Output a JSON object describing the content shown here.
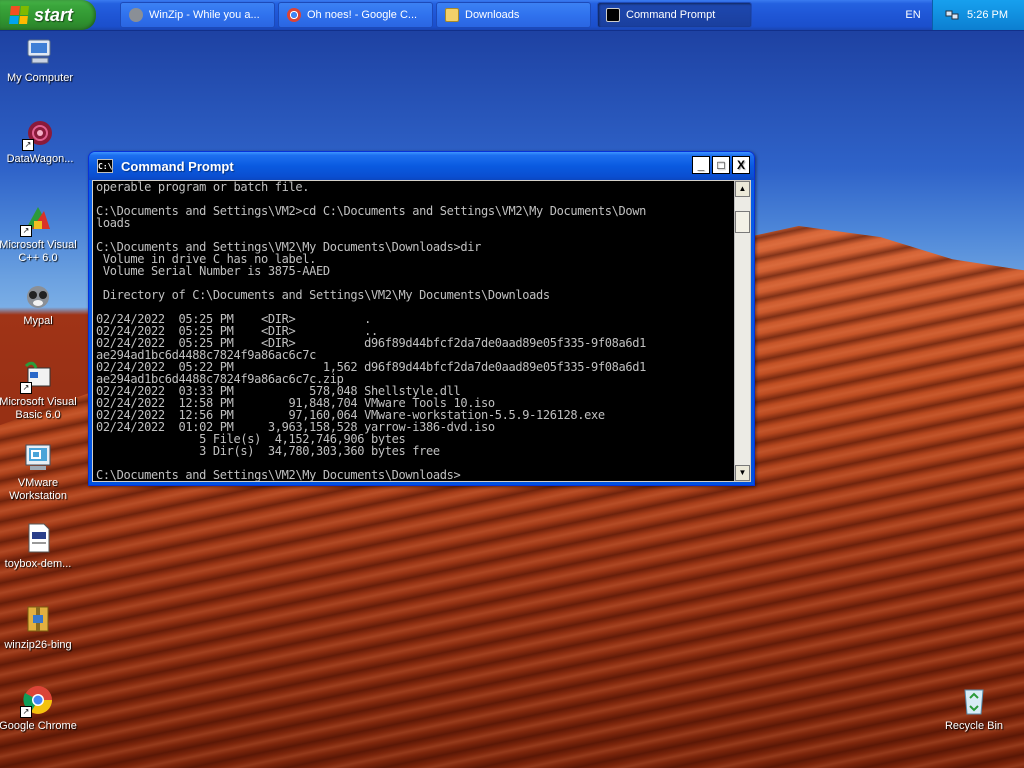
{
  "taskbar": {
    "start_label": "start",
    "tasks": [
      {
        "label": "WinZip - While you a...",
        "icon": "winzip-icon"
      },
      {
        "label": "Oh noes! - Google C...",
        "icon": "chrome-icon"
      },
      {
        "label": "Downloads",
        "icon": "folder-icon"
      },
      {
        "label": "Command Prompt",
        "icon": "cmd-icon",
        "active": true
      }
    ],
    "language": "EN",
    "clock": "5:26 PM"
  },
  "desktop_icons": [
    {
      "label": "My Computer",
      "icon": "computer-icon"
    },
    {
      "label": "DataWagon...",
      "icon": "datawagon-icon"
    },
    {
      "label": "Microsoft Visual C++ 6.0",
      "icon": "visual-cpp-icon"
    },
    {
      "label": "Mypal",
      "icon": "mypal-icon"
    },
    {
      "label": "Microsoft Visual Basic 6.0",
      "icon": "visual-basic-icon"
    },
    {
      "label": "VMware Workstation",
      "icon": "vmware-icon"
    },
    {
      "label": "toybox-dem...",
      "icon": "document-icon"
    },
    {
      "label": "winzip26-bing",
      "icon": "winzip-installer-icon"
    },
    {
      "label": "Google Chrome",
      "icon": "chrome-icon"
    },
    {
      "label": "Recycle Bin",
      "icon": "recycle-bin-icon"
    }
  ],
  "cmd_window": {
    "title": "Command Prompt",
    "icon_text": "C:\\",
    "minimize": "_",
    "maximize": "□",
    "close": "X",
    "console_text": "operable program or batch file.\n\nC:\\Documents and Settings\\VM2>cd C:\\Documents and Settings\\VM2\\My Documents\\Down\nloads\n\nC:\\Documents and Settings\\VM2\\My Documents\\Downloads>dir\n Volume in drive C has no label.\n Volume Serial Number is 3875-AAED\n\n Directory of C:\\Documents and Settings\\VM2\\My Documents\\Downloads\n\n02/24/2022  05:25 PM    <DIR>          .\n02/24/2022  05:25 PM    <DIR>          ..\n02/24/2022  05:25 PM    <DIR>          d96f89d44bfcf2da7de0aad89e05f335-9f08a6d1\nae294ad1bc6d4488c7824f9a86ac6c7c\n02/24/2022  05:22 PM             1,562 d96f89d44bfcf2da7de0aad89e05f335-9f08a6d1\nae294ad1bc6d4488c7824f9a86ac6c7c.zip\n02/24/2022  03:33 PM           578,048 Shellstyle.dll\n02/24/2022  12:58 PM        91,848,704 VMware Tools 10.iso\n02/24/2022  12:56 PM        97,160,064 VMware-workstation-5.5.9-126128.exe\n02/24/2022  01:02 PM     3,963,158,528 yarrow-i386-dvd.iso\n               5 File(s)  4,152,746,906 bytes\n               3 Dir(s)  34,780,303,360 bytes free\n\nC:\\Documents and Settings\\VM2\\My Documents\\Downloads>"
  }
}
